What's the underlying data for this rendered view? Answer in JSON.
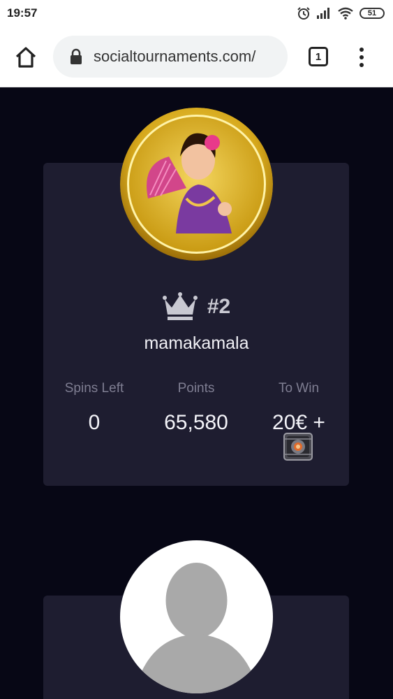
{
  "status_bar": {
    "time": "19:57",
    "battery": "51"
  },
  "browser": {
    "url": "socialtournaments.com/",
    "tab_count": "1"
  },
  "player_1": {
    "rank": "#2",
    "username": "mamakamala",
    "stats": [
      {
        "label": "Spins Left",
        "value": "0"
      },
      {
        "label": "Points",
        "value": "65,580"
      },
      {
        "label": "To Win",
        "value": "20€ +"
      }
    ]
  },
  "colors": {
    "background": "#070715",
    "card": "#1e1d30",
    "label": "#7f7e92",
    "value": "#f3f3f8"
  },
  "icons": [
    "home-icon",
    "lock-icon",
    "tabs-icon",
    "menu-icon",
    "crown-icon",
    "prize-box-icon",
    "alarm-icon",
    "signal-icon",
    "wifi-icon",
    "battery-icon"
  ]
}
